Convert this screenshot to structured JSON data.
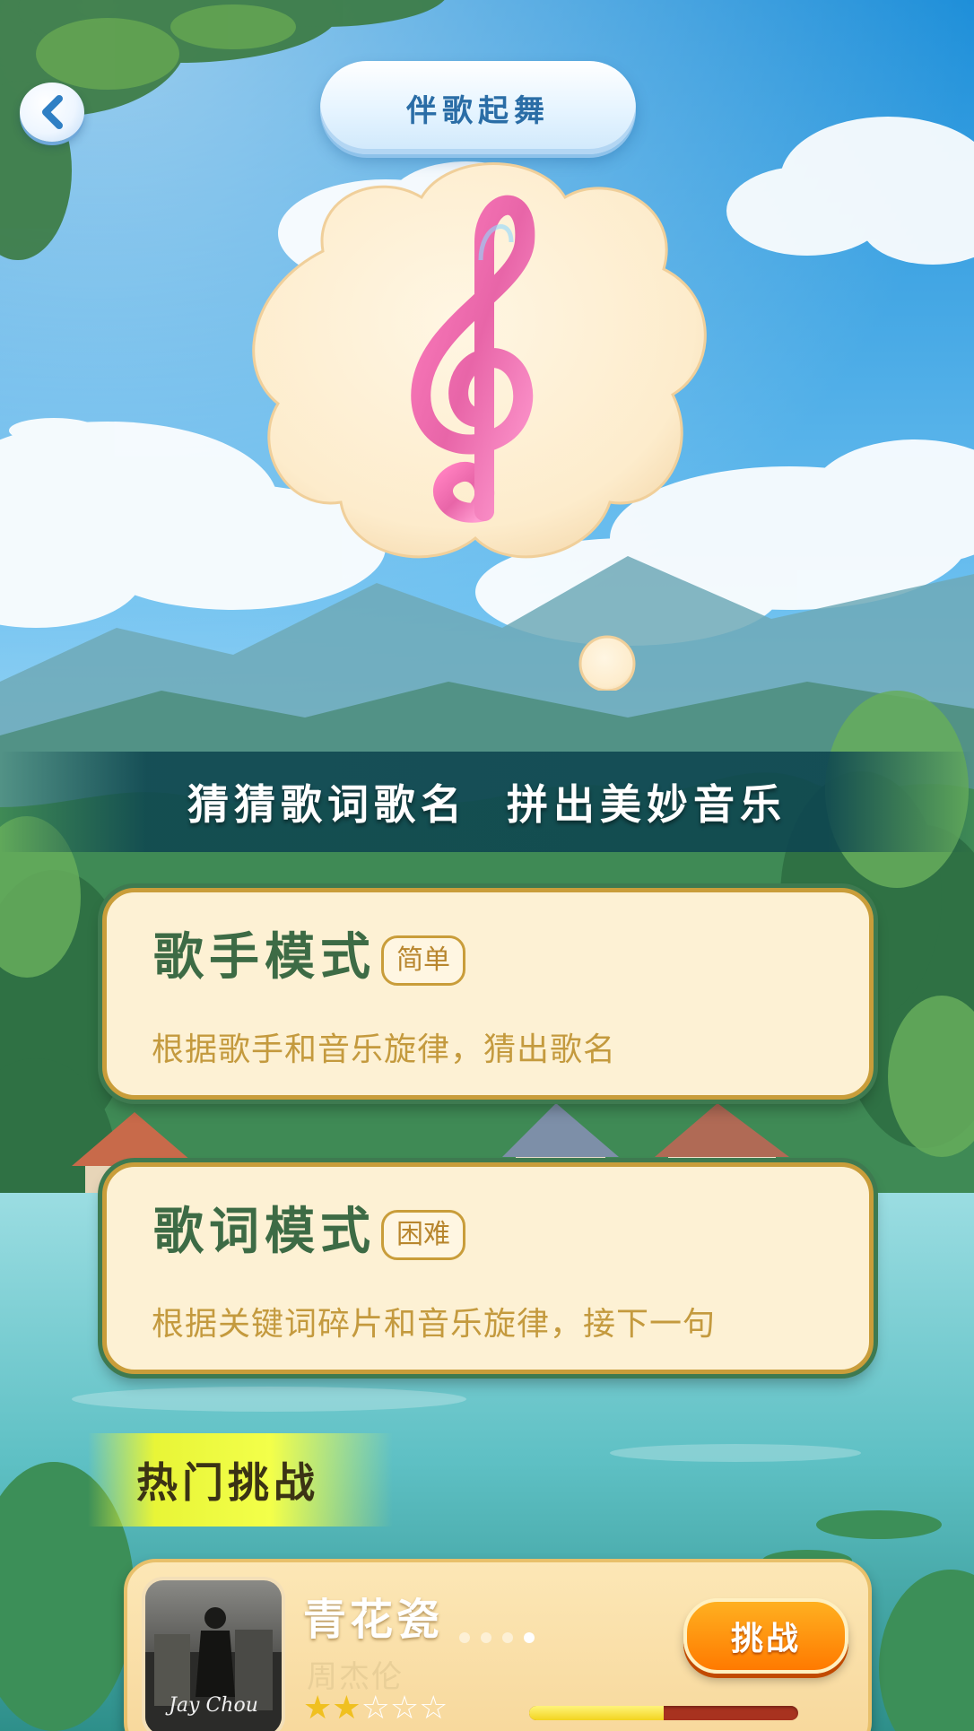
{
  "header": {
    "back_icon": "chevron-left-icon",
    "title": "伴歌起舞"
  },
  "hero": {
    "icon": "treble-clef-icon"
  },
  "slogan": "猜猜歌词歌名  拼出美妙音乐",
  "modes": [
    {
      "title": "歌手模式",
      "tag": "简单",
      "description": "根据歌手和音乐旋律，猜出歌名"
    },
    {
      "title": "歌词模式",
      "tag": "困难",
      "description": "根据关键词碎片和音乐旋律，接下一句"
    }
  ],
  "hot": {
    "heading": "热门挑战",
    "song": {
      "title": "青花瓷",
      "singer": "周杰伦",
      "cover_text": "Jay Chou",
      "rating": 2,
      "max_rating": 5,
      "challenge_label": "挑战",
      "progress": 0.5,
      "carousel_pages": 4,
      "carousel_active": 3
    }
  },
  "colors": {
    "accent_green": "#3d6b45",
    "accent_gold": "#c99d3a",
    "button_orange": "#ff8a00"
  }
}
